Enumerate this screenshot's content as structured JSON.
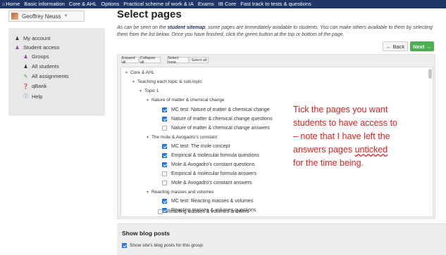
{
  "nav": {
    "items": [
      "Home",
      "Basic information",
      "Core & AHL",
      "Options",
      "Practical scheme of work & IA",
      "Exams",
      "IB Core",
      "Fast track to tests & questions"
    ]
  },
  "user": {
    "name": "Geoffrey Neuss"
  },
  "sidebar": {
    "items": [
      {
        "label": "My account",
        "icon": "user-icon"
      },
      {
        "label": "Student access",
        "icon": "users-icon"
      },
      {
        "label": "Groups",
        "icon": "group-icon"
      },
      {
        "label": "All students",
        "icon": "user-icon"
      },
      {
        "label": "All assignments",
        "icon": "pencil-icon"
      },
      {
        "label": "qBank",
        "icon": "help-circle-icon"
      },
      {
        "label": "Help",
        "icon": "info-icon"
      }
    ]
  },
  "page": {
    "title": "Select pages",
    "intro_before": "As can be seen on the ",
    "intro_link": "student sitemap",
    "intro_after": ", some pages are immediately available to students. You can make others available to them by selecting them from the list below. Once you have finished, click the green button at the top or bottom of the page.",
    "back_label": "Back",
    "next_label": "Next",
    "colors": {
      "next": "#4caf50",
      "nav": "#1f3566",
      "overlay": "#e02020",
      "checkbox": "#2b7de9"
    }
  },
  "toolbar": {
    "expand_all": "Expand all",
    "collapse_all": "Collapse all",
    "select_none": "Select none",
    "select_all": "Select all"
  },
  "tree": {
    "root": "Core & AHL",
    "level1": "Teaching each topic & sub-topic",
    "level2": "Topic 1",
    "groups": [
      {
        "title": "Nature of matter & chemical change",
        "leaves": [
          {
            "label": "MC test: Nature of matter & chemical change",
            "checked": true
          },
          {
            "label": "Nature of matter & chemical change questions",
            "checked": true
          },
          {
            "label": "Nature of matter & chemical change answers",
            "checked": false
          }
        ]
      },
      {
        "title": "The mole & Avogadro's constant",
        "leaves": [
          {
            "label": "MC test: The mole concept",
            "checked": true
          },
          {
            "label": "Empirical & molecular formula questions",
            "checked": true
          },
          {
            "label": "Mole & Avogadro's constant questions",
            "checked": true
          },
          {
            "label": "Empirical & molecular formula answers",
            "checked": false
          },
          {
            "label": "Mole & Avogadro's constant answers",
            "checked": false
          }
        ]
      },
      {
        "title": "Reacting masses and volumes",
        "leaves": [
          {
            "label": "MC test: Reacting masses & volumes",
            "checked": true
          },
          {
            "label": "Reacting masses & volumes questions",
            "checked": true
          },
          {
            "label": "Reacting masses & volumes answers",
            "checked": false
          }
        ]
      }
    ]
  },
  "overlay": {
    "line1": "Tick the pages you want",
    "line2": "students to have access to",
    "line3": "– note that I have left the",
    "line4a": "answers pages ",
    "line4b": "unticked",
    "line5": "for the time being."
  },
  "blog": {
    "title": "Show blog posts",
    "checkbox_label": "Show site's blog posts for this group",
    "checked": true
  }
}
